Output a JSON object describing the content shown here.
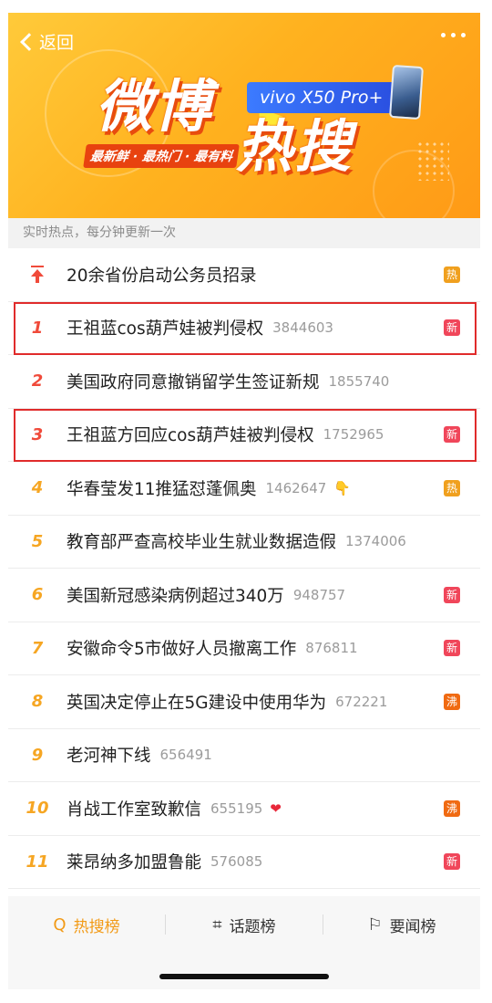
{
  "header": {
    "back_label": "返回",
    "logo_part1": "微博",
    "logo_part2": "热搜",
    "sponsor": "vivo X50 Pro+",
    "slogan": "最新鲜 · 最热门 · 最有料"
  },
  "subheader": "实时热点，每分钟更新一次",
  "pinned": {
    "title": "20余省份启动公务员招录",
    "badge": "热",
    "badge_color": "#f0a01e"
  },
  "items": [
    {
      "rank": "1",
      "title": "王祖蓝cos葫芦娃被判侵权",
      "count": "3844603",
      "badge": "新",
      "badge_color": "#f0465a",
      "highlighted": true
    },
    {
      "rank": "2",
      "title": "美国政府同意撤销留学生签证新规",
      "count": "1855740",
      "badge": "",
      "badge_color": ""
    },
    {
      "rank": "3",
      "title": "王祖蓝方回应cos葫芦娃被判侵权",
      "count": "1752965",
      "badge": "新",
      "badge_color": "#f0465a",
      "highlighted": true
    },
    {
      "rank": "4",
      "title": "华春莹发11推猛怼蓬佩奥",
      "count": "1462647",
      "emoji": "👇",
      "badge": "热",
      "badge_color": "#f0a01e"
    },
    {
      "rank": "5",
      "title": "教育部严查高校毕业生就业数据造假",
      "count": "1374006",
      "badge": "",
      "badge_color": ""
    },
    {
      "rank": "6",
      "title": "美国新冠感染病例超过340万",
      "count": "948757",
      "badge": "新",
      "badge_color": "#f0465a"
    },
    {
      "rank": "7",
      "title": "安徽命令5市做好人员撤离工作",
      "count": "876811",
      "badge": "新",
      "badge_color": "#f0465a"
    },
    {
      "rank": "8",
      "title": "英国决定停止在5G建设中使用华为",
      "count": "672221",
      "badge": "沸",
      "badge_color": "#f06a12"
    },
    {
      "rank": "9",
      "title": "老河神下线",
      "count": "656491",
      "badge": "",
      "badge_color": ""
    },
    {
      "rank": "10",
      "title": "肖战工作室致歉信",
      "count": "655195",
      "emoji": "❤",
      "badge": "沸",
      "badge_color": "#f06a12"
    },
    {
      "rank": "11",
      "title": "莱昂纳多加盟鲁能",
      "count": "576085",
      "badge": "新",
      "badge_color": "#f0465a"
    }
  ],
  "tabs": [
    {
      "label": "热搜榜",
      "icon": "search-q-icon",
      "active": true
    },
    {
      "label": "话题榜",
      "icon": "hashtag-icon",
      "active": false
    },
    {
      "label": "要闻榜",
      "icon": "news-flag-icon",
      "active": false
    }
  ],
  "colors": {
    "accent": "#f29a16",
    "top_rank": "#f04a3a",
    "rank": "#f6a623",
    "highlight_box": "#e02b2b"
  }
}
